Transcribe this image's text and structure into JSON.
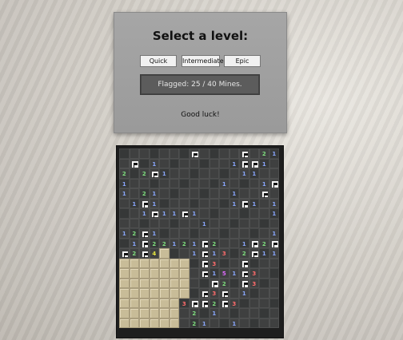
{
  "panel": {
    "title": "Select a level:",
    "buttons": [
      "Quick",
      "Intermediate",
      "Epic"
    ],
    "status": "Flagged: 25 / 40 Mines.",
    "message": "Good luck!"
  },
  "number_colors": {
    "1": "#8aa8ff",
    "2": "#7fe07f",
    "3": "#ff6b6b",
    "4": "#e6e640",
    "5": "#e06bff"
  },
  "board": {
    "rows": [
      ".......F....F.21",
      ".F.1.......1FF1.",
      "2.2F1.......11..",
      "1.........1...1F",
      "1.21.......1..F.",
      ".1F1.......1F1.1",
      "..1F11F1.......1",
      "........1.......",
      "12F1...........1",
      ".1F22121F2..1F2F",
      "F2F4#..1F13.2F11",
      "#######.F3..F...",
      "#######.F151F3..",
      "#######..F2.F3..",
      "#######.F3F.1...",
      "######3FF2F3....",
      "######.2.1......",
      "######.21..1...."
    ]
  }
}
